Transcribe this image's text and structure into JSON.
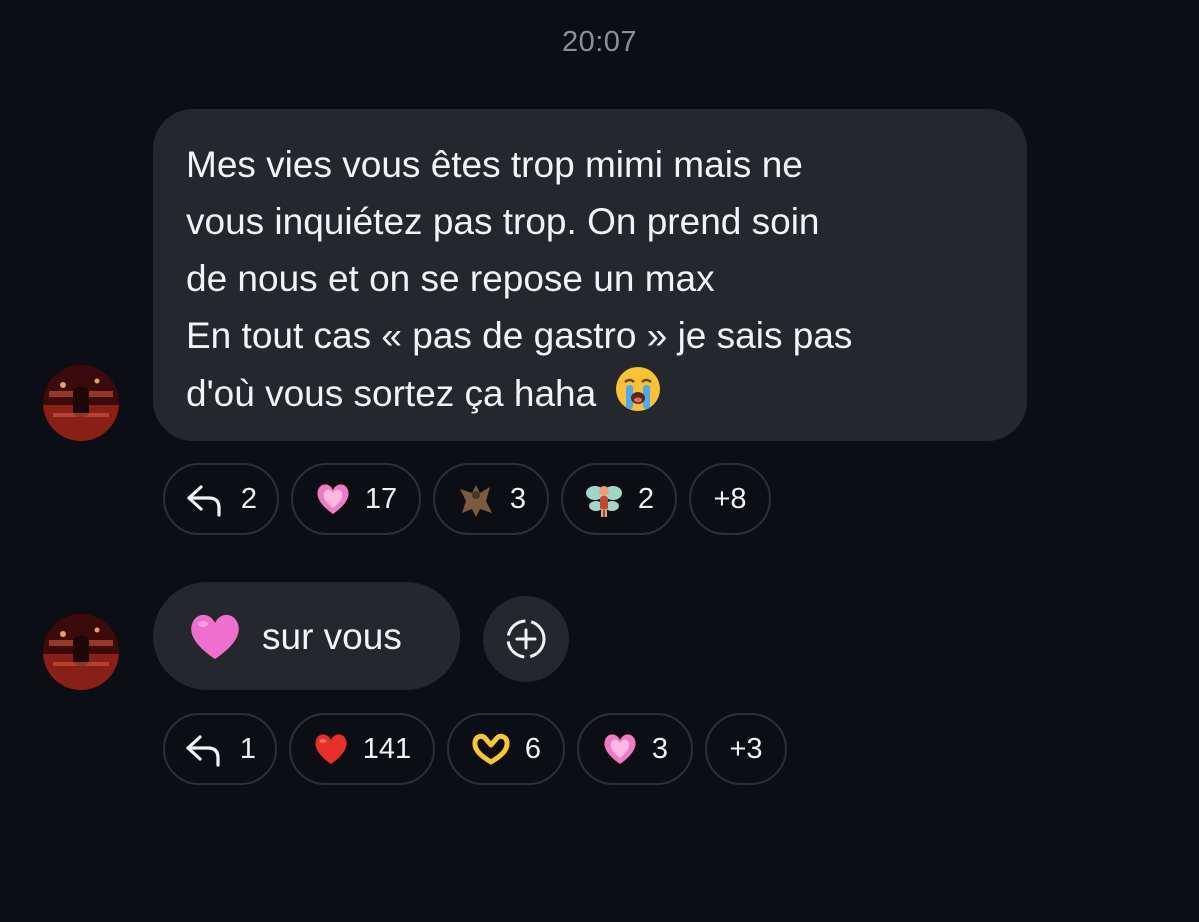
{
  "timestamp": "20:07",
  "message1": {
    "lines": [
      "Mes vies vous êtes trop mimi mais ne",
      "vous inquiétez pas trop. On prend soin",
      "de nous et on se repose un max",
      "En tout cas « pas de gastro » je sais pas",
      "d'où vous sortez ça haha"
    ],
    "emoji": "loudly-crying-face"
  },
  "reactions1": [
    {
      "icon": "reply-arrow",
      "count": "2"
    },
    {
      "icon": "growing-heart",
      "count": "17"
    },
    {
      "icon": "bat",
      "count": "3"
    },
    {
      "icon": "fairy",
      "count": "2"
    },
    {
      "icon": "more",
      "count": "+8"
    }
  ],
  "message2": {
    "emoji": "pink-heart",
    "text": "sur vous"
  },
  "reactions2": [
    {
      "icon": "reply-arrow",
      "count": "1"
    },
    {
      "icon": "red-heart",
      "count": "141"
    },
    {
      "icon": "heart-hands",
      "count": "6"
    },
    {
      "icon": "growing-heart",
      "count": "3"
    },
    {
      "icon": "more",
      "count": "+3"
    }
  ],
  "colors": {
    "background": "#0c0e13",
    "bubble": "#25272c",
    "chip_border": "#2c2f35",
    "timestamp": "#8c8f96",
    "text": "#f3f4f6"
  }
}
